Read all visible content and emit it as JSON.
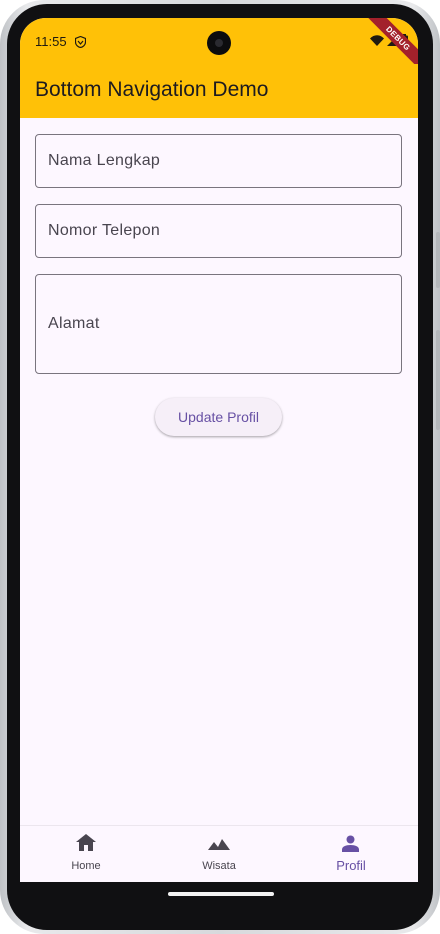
{
  "status_bar": {
    "time": "11:55",
    "debug_banner": "DEBUG"
  },
  "app_bar": {
    "title": "Bottom Navigation Demo",
    "background": "#ffc107"
  },
  "form": {
    "fields": [
      {
        "label": "Nama Lengkap",
        "value": ""
      },
      {
        "label": "Nomor Telepon",
        "value": ""
      },
      {
        "label": "Alamat",
        "value": ""
      }
    ],
    "submit_label": "Update Profil"
  },
  "bottom_nav": {
    "items": [
      {
        "label": "Home",
        "icon": "home-icon",
        "active": false
      },
      {
        "label": "Wisata",
        "icon": "landscape-icon",
        "active": false
      },
      {
        "label": "Profil",
        "icon": "person-icon",
        "active": true
      }
    ],
    "active_color": "#6750a4"
  }
}
